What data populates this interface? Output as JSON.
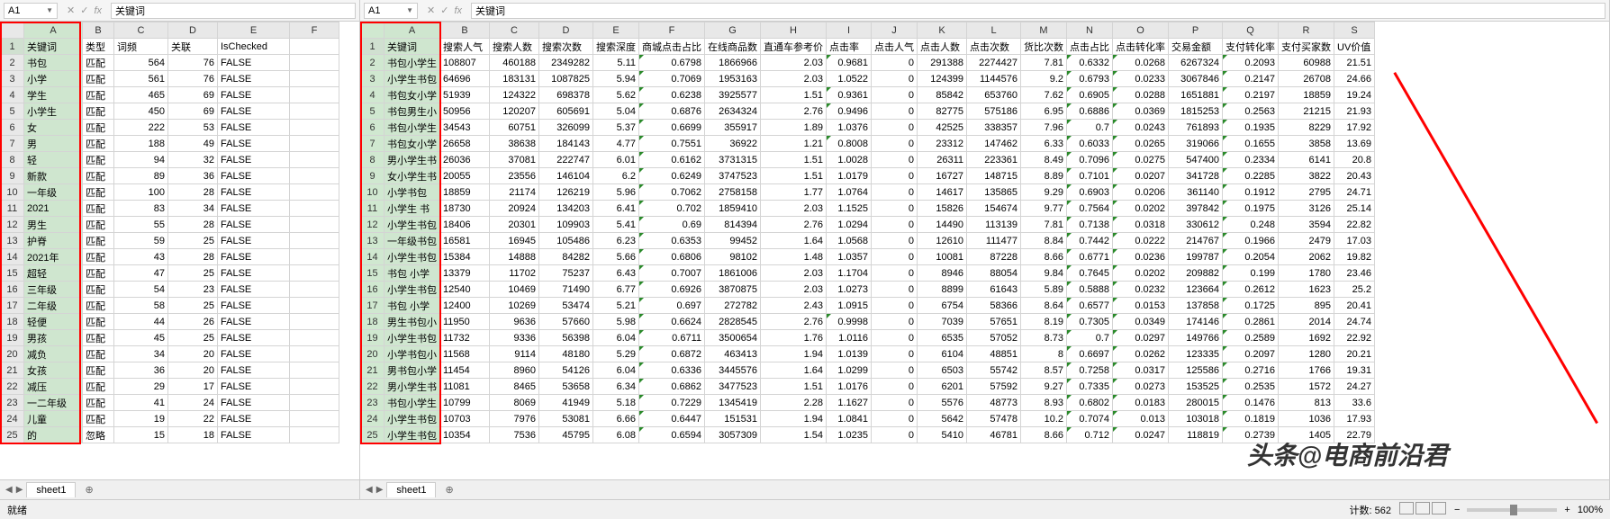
{
  "nameBox": "A1",
  "formula": "关键词",
  "statusLeft": "就绪",
  "statusCount": "计数: 562",
  "zoom": "100%",
  "sheetTab": "sheet1",
  "watermark": "头条@电商前沿君",
  "left": {
    "headers": [
      "A",
      "B",
      "C",
      "D",
      "E",
      "F"
    ],
    "rows": [
      [
        "关键词",
        "类型",
        "词频",
        "关联",
        "IsChecked",
        ""
      ],
      [
        "书包",
        "匹配",
        "564",
        "76",
        "FALSE",
        ""
      ],
      [
        "小学",
        "匹配",
        "561",
        "76",
        "FALSE",
        ""
      ],
      [
        "学生",
        "匹配",
        "465",
        "69",
        "FALSE",
        ""
      ],
      [
        "小学生",
        "匹配",
        "450",
        "69",
        "FALSE",
        ""
      ],
      [
        "女",
        "匹配",
        "222",
        "53",
        "FALSE",
        ""
      ],
      [
        "男",
        "匹配",
        "188",
        "49",
        "FALSE",
        ""
      ],
      [
        "轻",
        "匹配",
        "94",
        "32",
        "FALSE",
        ""
      ],
      [
        "新款",
        "匹配",
        "89",
        "36",
        "FALSE",
        ""
      ],
      [
        "一年级",
        "匹配",
        "100",
        "28",
        "FALSE",
        ""
      ],
      [
        "2021",
        "匹配",
        "83",
        "34",
        "FALSE",
        ""
      ],
      [
        "男生",
        "匹配",
        "55",
        "28",
        "FALSE",
        ""
      ],
      [
        "护脊",
        "匹配",
        "59",
        "25",
        "FALSE",
        ""
      ],
      [
        "2021年",
        "匹配",
        "43",
        "28",
        "FALSE",
        ""
      ],
      [
        "超轻",
        "匹配",
        "47",
        "25",
        "FALSE",
        ""
      ],
      [
        "三年级",
        "匹配",
        "54",
        "23",
        "FALSE",
        ""
      ],
      [
        "二年级",
        "匹配",
        "58",
        "25",
        "FALSE",
        ""
      ],
      [
        "轻便",
        "匹配",
        "44",
        "26",
        "FALSE",
        ""
      ],
      [
        "男孩",
        "匹配",
        "45",
        "25",
        "FALSE",
        ""
      ],
      [
        "减负",
        "匹配",
        "34",
        "20",
        "FALSE",
        ""
      ],
      [
        "女孩",
        "匹配",
        "36",
        "20",
        "FALSE",
        ""
      ],
      [
        "减压",
        "匹配",
        "29",
        "17",
        "FALSE",
        ""
      ],
      [
        "一二年级",
        "匹配",
        "41",
        "24",
        "FALSE",
        ""
      ],
      [
        "儿童",
        "匹配",
        "19",
        "22",
        "FALSE",
        ""
      ],
      [
        "的",
        "忽略",
        "15",
        "18",
        "FALSE",
        ""
      ]
    ]
  },
  "right": {
    "headers": [
      "A",
      "B",
      "C",
      "D",
      "E",
      "F",
      "G",
      "H",
      "I",
      "J",
      "K",
      "L",
      "M",
      "N",
      "O",
      "P",
      "Q",
      "R",
      "S"
    ],
    "colTitles": [
      "关键词",
      "搜索人气",
      "搜索人数",
      "搜索次数",
      "搜索深度",
      "商城点击占比",
      "在线商品数",
      "直通车参考价",
      "点击率",
      "点击人气",
      "点击人数",
      "点击次数",
      "货比次数",
      "点击占比",
      "点击转化率",
      "交易金额",
      "支付转化率",
      "支付买家数",
      "UV价值"
    ],
    "rows": [
      [
        "书包小学生",
        "108807",
        "460188",
        "2349282",
        "5.11",
        "0.6798",
        "1866966",
        "2.03",
        "0.9681",
        "0",
        "291388",
        "2274427",
        "7.81",
        "0.6332",
        "0.0268",
        "6267324",
        "0.2093",
        "60988",
        "21.51"
      ],
      [
        "小学生书包",
        "64696",
        "183131",
        "1087825",
        "5.94",
        "0.7069",
        "1953163",
        "2.03",
        "1.0522",
        "0",
        "124399",
        "1144576",
        "9.2",
        "0.6793",
        "0.0233",
        "3067846",
        "0.2147",
        "26708",
        "24.66"
      ],
      [
        "书包女小学",
        "51939",
        "124322",
        "698378",
        "5.62",
        "0.6238",
        "3925577",
        "1.51",
        "0.9361",
        "0",
        "85842",
        "653760",
        "7.62",
        "0.6905",
        "0.0288",
        "1651881",
        "0.2197",
        "18859",
        "19.24"
      ],
      [
        "书包男生小",
        "50956",
        "120207",
        "605691",
        "5.04",
        "0.6876",
        "2634324",
        "2.76",
        "0.9496",
        "0",
        "82775",
        "575186",
        "6.95",
        "0.6886",
        "0.0369",
        "1815253",
        "0.2563",
        "21215",
        "21.93"
      ],
      [
        "书包小学生",
        "34543",
        "60751",
        "326099",
        "5.37",
        "0.6699",
        "355917",
        "1.89",
        "1.0376",
        "0",
        "42525",
        "338357",
        "7.96",
        "0.7",
        "0.0243",
        "761893",
        "0.1935",
        "8229",
        "17.92"
      ],
      [
        "书包女小学",
        "26658",
        "38638",
        "184143",
        "4.77",
        "0.7551",
        "36922",
        "1.21",
        "0.8008",
        "0",
        "23312",
        "147462",
        "6.33",
        "0.6033",
        "0.0265",
        "319066",
        "0.1655",
        "3858",
        "13.69"
      ],
      [
        "男小学生书",
        "26036",
        "37081",
        "222747",
        "6.01",
        "0.6162",
        "3731315",
        "1.51",
        "1.0028",
        "0",
        "26311",
        "223361",
        "8.49",
        "0.7096",
        "0.0275",
        "547400",
        "0.2334",
        "6141",
        "20.8"
      ],
      [
        "女小学生书",
        "20055",
        "23556",
        "146104",
        "6.2",
        "0.6249",
        "3747523",
        "1.51",
        "1.0179",
        "0",
        "16727",
        "148715",
        "8.89",
        "0.7101",
        "0.0207",
        "341728",
        "0.2285",
        "3822",
        "20.43"
      ],
      [
        "小学书包",
        "18859",
        "21174",
        "126219",
        "5.96",
        "0.7062",
        "2758158",
        "1.77",
        "1.0764",
        "0",
        "14617",
        "135865",
        "9.29",
        "0.6903",
        "0.0206",
        "361140",
        "0.1912",
        "2795",
        "24.71"
      ],
      [
        "小学生 书",
        "18730",
        "20924",
        "134203",
        "6.41",
        "0.702",
        "1859410",
        "2.03",
        "1.1525",
        "0",
        "15826",
        "154674",
        "9.77",
        "0.7564",
        "0.0202",
        "397842",
        "0.1975",
        "3126",
        "25.14"
      ],
      [
        "小学生书包",
        "18406",
        "20301",
        "109903",
        "5.41",
        "0.69",
        "814394",
        "2.76",
        "1.0294",
        "0",
        "14490",
        "113139",
        "7.81",
        "0.7138",
        "0.0318",
        "330612",
        "0.248",
        "3594",
        "22.82"
      ],
      [
        "一年级书包",
        "16581",
        "16945",
        "105486",
        "6.23",
        "0.6353",
        "99452",
        "1.64",
        "1.0568",
        "0",
        "12610",
        "111477",
        "8.84",
        "0.7442",
        "0.0222",
        "214767",
        "0.1966",
        "2479",
        "17.03"
      ],
      [
        "小学生书包",
        "15384",
        "14888",
        "84282",
        "5.66",
        "0.6806",
        "98102",
        "1.48",
        "1.0357",
        "0",
        "10081",
        "87228",
        "8.66",
        "0.6771",
        "0.0236",
        "199787",
        "0.2054",
        "2062",
        "19.82"
      ],
      [
        "书包 小学",
        "13379",
        "11702",
        "75237",
        "6.43",
        "0.7007",
        "1861006",
        "2.03",
        "1.1704",
        "0",
        "8946",
        "88054",
        "9.84",
        "0.7645",
        "0.0202",
        "209882",
        "0.199",
        "1780",
        "23.46"
      ],
      [
        "小学生书包",
        "12540",
        "10469",
        "71490",
        "6.77",
        "0.6926",
        "3870875",
        "2.03",
        "1.0273",
        "0",
        "8899",
        "61643",
        "5.89",
        "0.5888",
        "0.0232",
        "123664",
        "0.2612",
        "1623",
        "25.2"
      ],
      [
        "书包 小学",
        "12400",
        "10269",
        "53474",
        "5.21",
        "0.697",
        "272782",
        "2.43",
        "1.0915",
        "0",
        "6754",
        "58366",
        "8.64",
        "0.6577",
        "0.0153",
        "137858",
        "0.1725",
        "895",
        "20.41"
      ],
      [
        "男生书包小",
        "11950",
        "9636",
        "57660",
        "5.98",
        "0.6624",
        "2828545",
        "2.76",
        "0.9998",
        "0",
        "7039",
        "57651",
        "8.19",
        "0.7305",
        "0.0349",
        "174146",
        "0.2861",
        "2014",
        "24.74"
      ],
      [
        "小学生书包",
        "11732",
        "9336",
        "56398",
        "6.04",
        "0.6711",
        "3500654",
        "1.76",
        "1.0116",
        "0",
        "6535",
        "57052",
        "8.73",
        "0.7",
        "0.0297",
        "149766",
        "0.2589",
        "1692",
        "22.92"
      ],
      [
        "小学书包小",
        "11568",
        "9114",
        "48180",
        "5.29",
        "0.6872",
        "463413",
        "1.94",
        "1.0139",
        "0",
        "6104",
        "48851",
        "8",
        "0.6697",
        "0.0262",
        "123335",
        "0.2097",
        "1280",
        "20.21"
      ],
      [
        "男书包小学",
        "11454",
        "8960",
        "54126",
        "6.04",
        "0.6336",
        "3445576",
        "1.64",
        "1.0299",
        "0",
        "6503",
        "55742",
        "8.57",
        "0.7258",
        "0.0317",
        "125586",
        "0.2716",
        "1766",
        "19.31"
      ],
      [
        "男小学生书",
        "11081",
        "8465",
        "53658",
        "6.34",
        "0.6862",
        "3477523",
        "1.51",
        "1.0176",
        "0",
        "6201",
        "57592",
        "9.27",
        "0.7335",
        "0.0273",
        "153525",
        "0.2535",
        "1572",
        "24.27"
      ],
      [
        "书包小学生",
        "10799",
        "8069",
        "41949",
        "5.18",
        "0.7229",
        "1345419",
        "2.28",
        "1.1627",
        "0",
        "5576",
        "48773",
        "8.93",
        "0.6802",
        "0.0183",
        "280015",
        "0.1476",
        "813",
        "33.6"
      ],
      [
        "小学生书包",
        "10703",
        "7976",
        "53081",
        "6.66",
        "0.6447",
        "151531",
        "1.94",
        "1.0841",
        "0",
        "5642",
        "57478",
        "10.2",
        "0.7074",
        "0.013",
        "103018",
        "0.1819",
        "1036",
        "17.93"
      ],
      [
        "小学生书包",
        "10354",
        "7536",
        "45795",
        "6.08",
        "0.6594",
        "3057309",
        "1.54",
        "1.0235",
        "0",
        "5410",
        "46781",
        "8.66",
        "0.712",
        "0.0247",
        "118819",
        "0.2739",
        "1405",
        "22.79"
      ]
    ]
  }
}
